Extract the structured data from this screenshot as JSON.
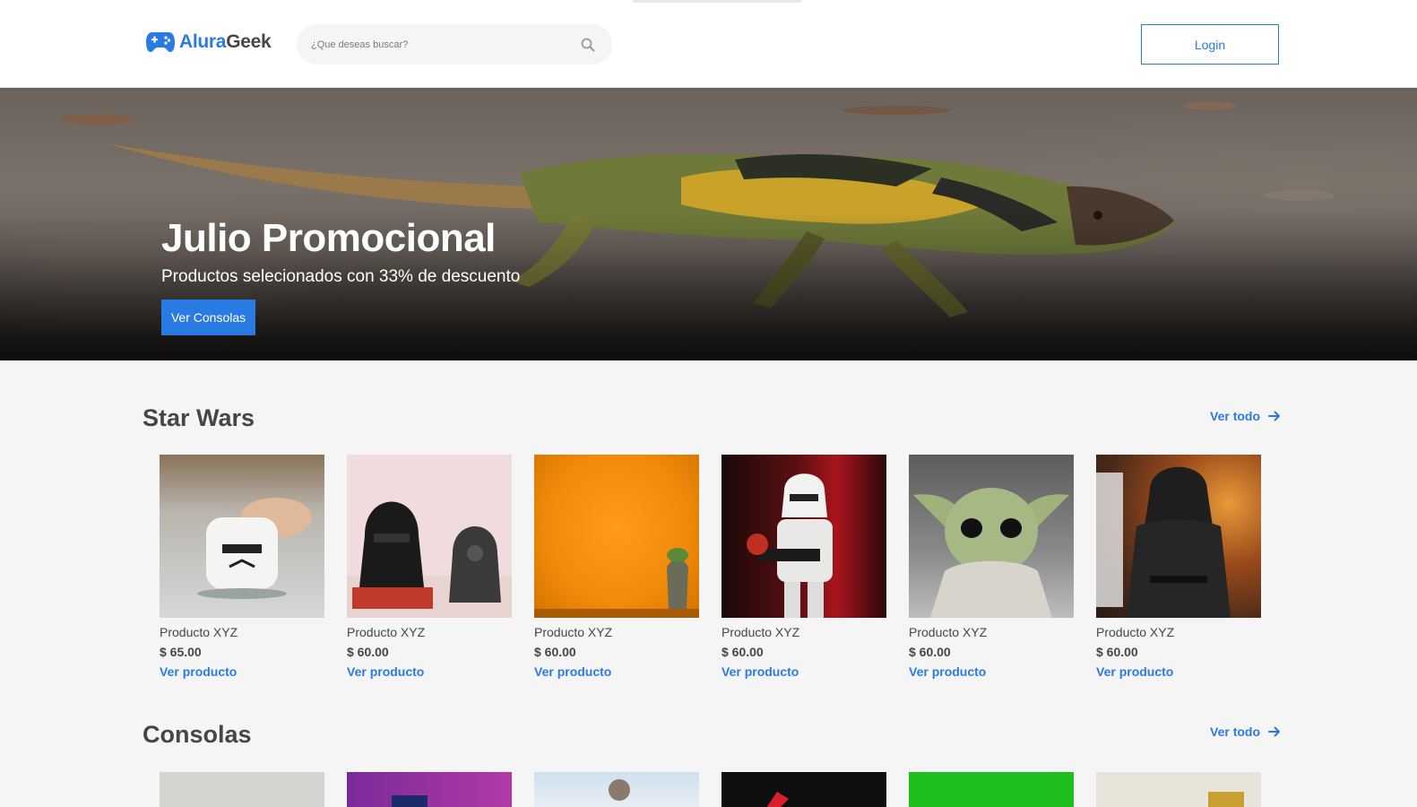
{
  "header": {
    "logo_part1": "Alura",
    "logo_part2": "Geek",
    "search_placeholder": "¿Que deseas buscar?",
    "login_label": "Login"
  },
  "hero": {
    "title": "Julio Promocional",
    "subtitle": "Productos selecionados con 33% de descuento",
    "button_label": "Ver Consolas"
  },
  "sections": [
    {
      "title": "Star Wars",
      "see_all": "Ver todo",
      "products": [
        {
          "name": "Producto XYZ",
          "price": "$ 65.00",
          "link": "Ver producto"
        },
        {
          "name": "Producto XYZ",
          "price": "$ 60.00",
          "link": "Ver producto"
        },
        {
          "name": "Producto XYZ",
          "price": "$ 60.00",
          "link": "Ver producto"
        },
        {
          "name": "Producto XYZ",
          "price": "$ 60.00",
          "link": "Ver producto"
        },
        {
          "name": "Producto XYZ",
          "price": "$ 60.00",
          "link": "Ver producto"
        },
        {
          "name": "Producto XYZ",
          "price": "$ 60.00",
          "link": "Ver producto"
        }
      ]
    },
    {
      "title": "Consolas",
      "see_all": "Ver todo"
    }
  ],
  "colors": {
    "accent": "#2a7ae4",
    "text": "#464646",
    "background": "#f5f5f5"
  },
  "icons": {
    "logo": "gamepad-icon",
    "search": "search-icon",
    "see_all": "arrow-right-icon"
  }
}
